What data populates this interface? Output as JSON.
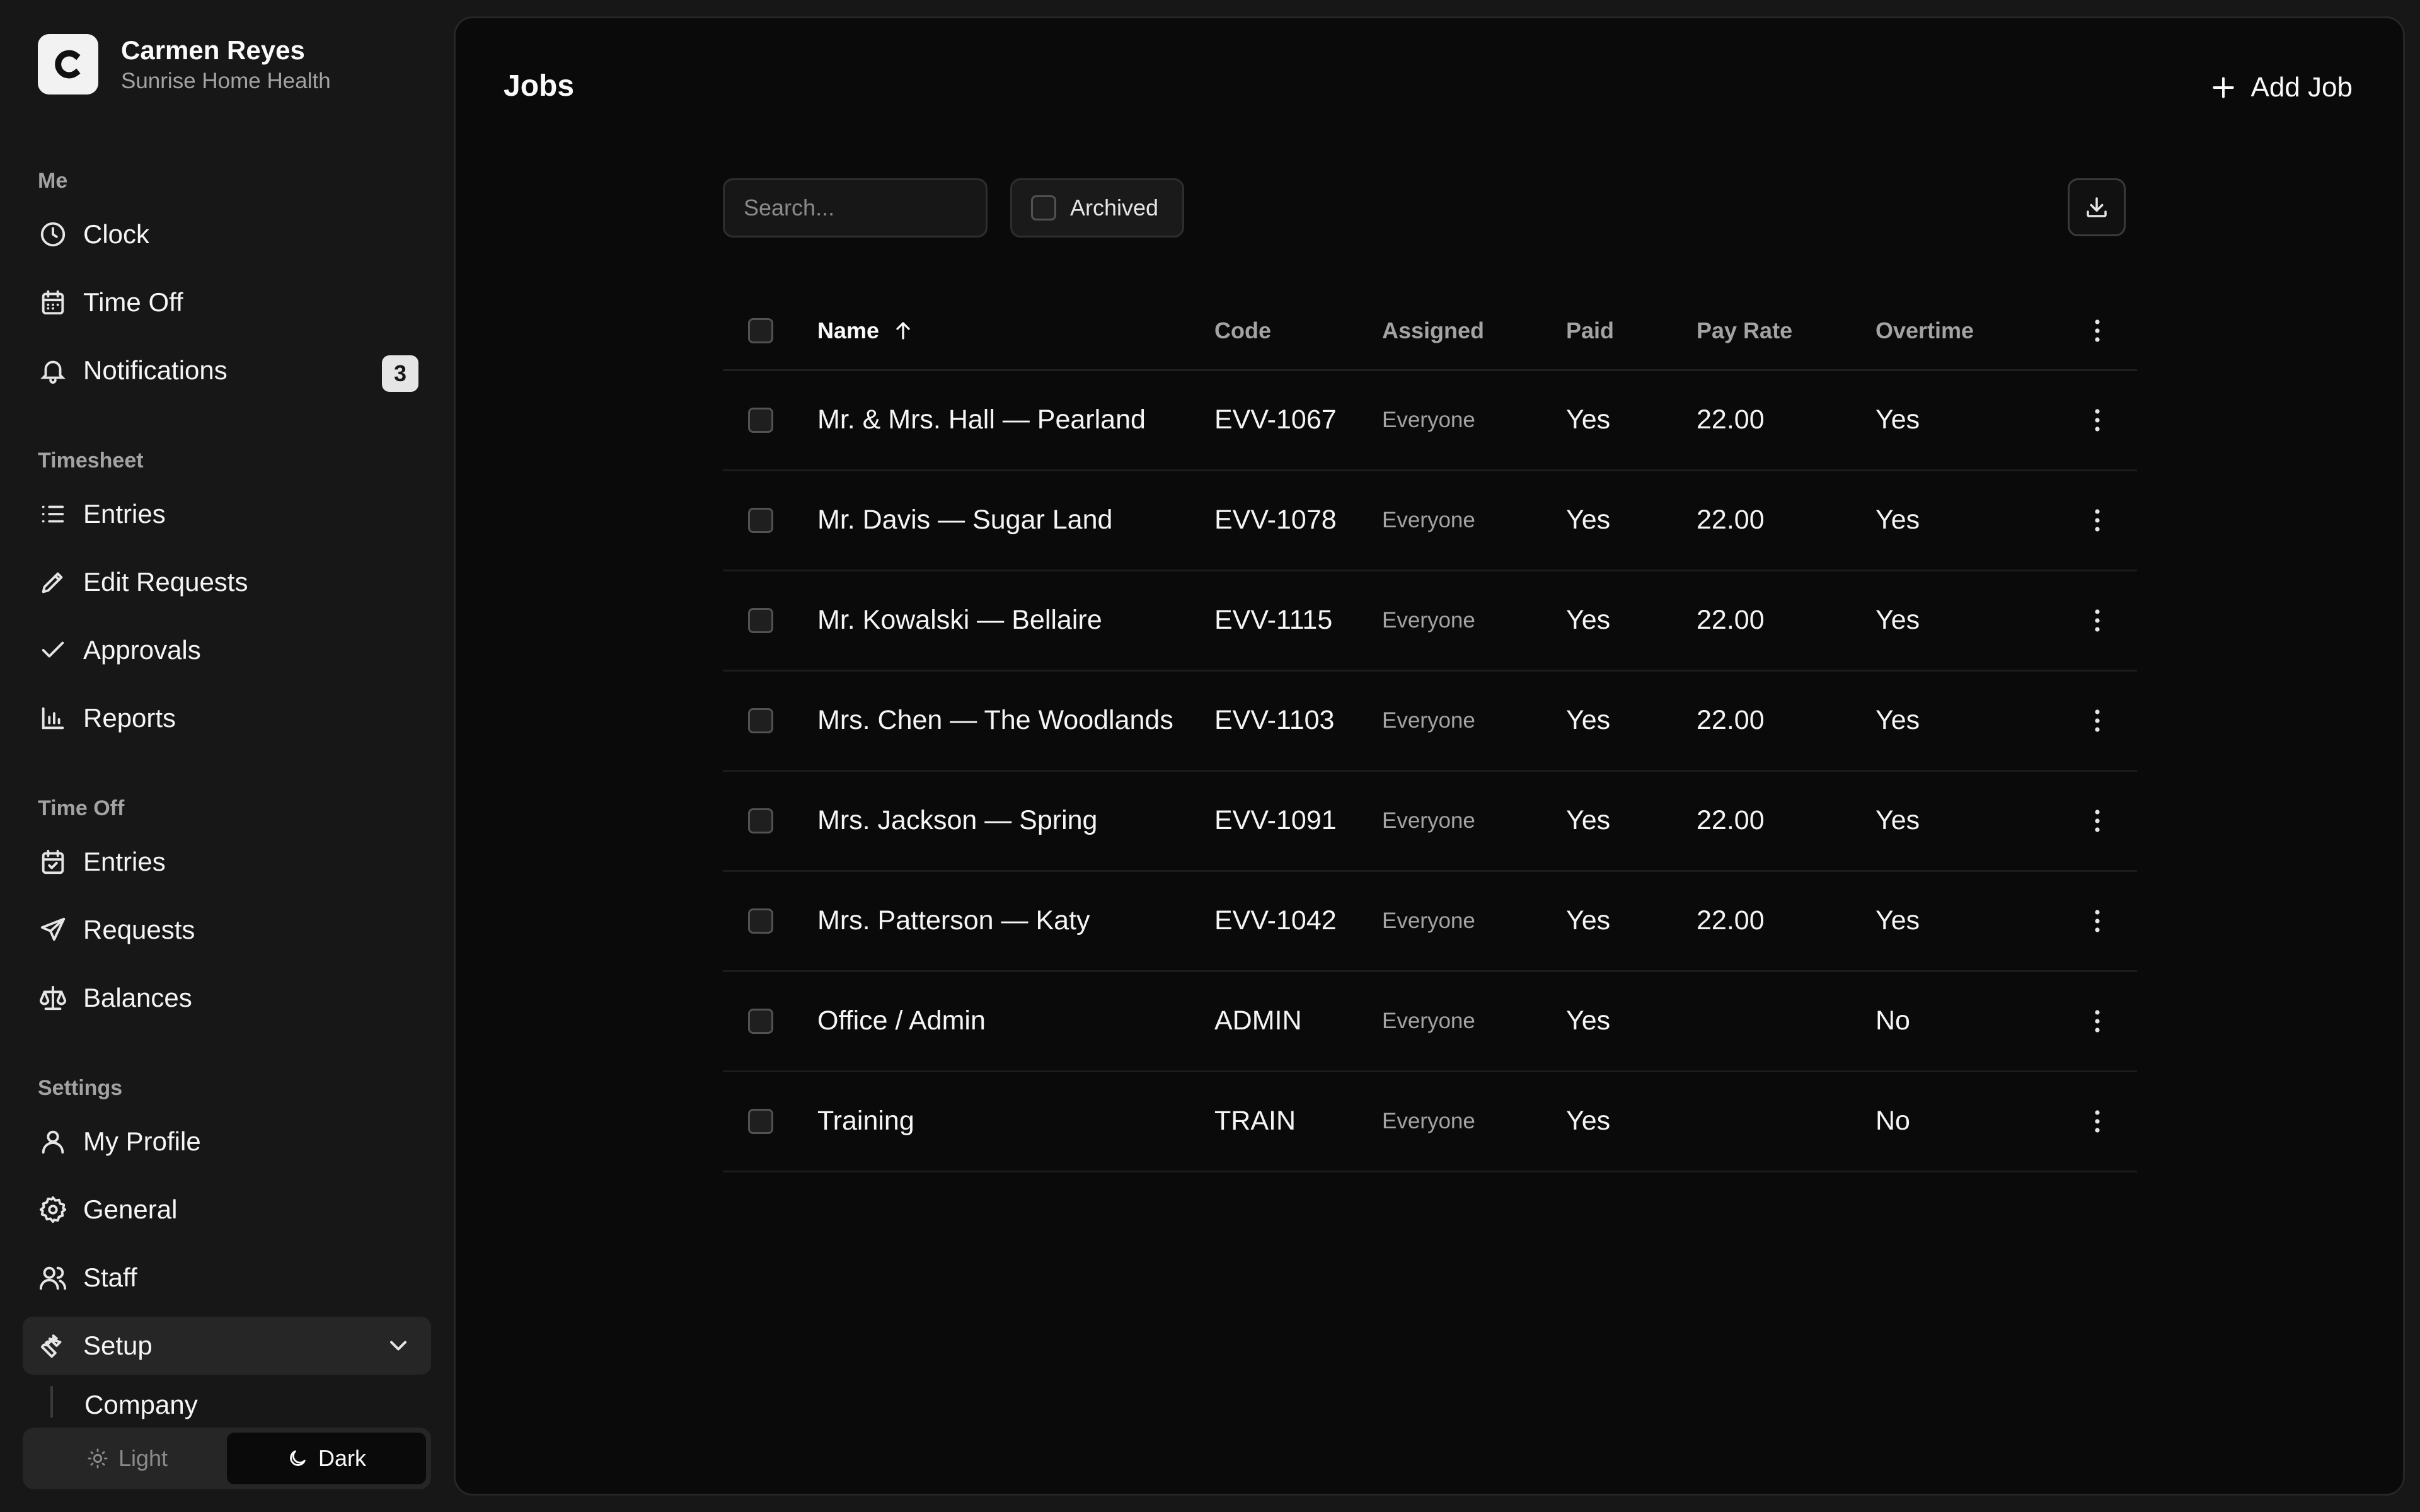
{
  "sidebar": {
    "brand": {
      "initial": "C",
      "name": "Carmen Reyes",
      "org": "Sunrise Home Health"
    },
    "sections": {
      "me": "Me",
      "timesheet": "Timesheet",
      "time_off": "Time Off",
      "settings": "Settings"
    },
    "items": {
      "clock": "Clock",
      "time_off": "Time Off",
      "notifications": "Notifications",
      "notifications_count": "3",
      "ts_entries": "Entries",
      "edit_requests": "Edit Requests",
      "approvals": "Approvals",
      "reports": "Reports",
      "to_entries": "Entries",
      "requests": "Requests",
      "balances": "Balances",
      "my_profile": "My Profile",
      "general": "General",
      "staff": "Staff",
      "setup": "Setup",
      "company": "Company"
    },
    "theme": {
      "light": "Light",
      "dark": "Dark",
      "selected": "Dark"
    }
  },
  "main": {
    "title": "Jobs",
    "add_label": "Add Job",
    "search_placeholder": "Search...",
    "archived_label": "Archived",
    "columns": [
      "Name",
      "Code",
      "Assigned",
      "Paid",
      "Pay Rate",
      "Overtime"
    ],
    "rows": [
      {
        "name": "Mr. & Mrs. Hall — Pearland",
        "code": "EVV-1067",
        "assigned": "Everyone",
        "paid": "Yes",
        "rate": "22.00",
        "overtime": "Yes"
      },
      {
        "name": "Mr. Davis — Sugar Land",
        "code": "EVV-1078",
        "assigned": "Everyone",
        "paid": "Yes",
        "rate": "22.00",
        "overtime": "Yes"
      },
      {
        "name": "Mr. Kowalski — Bellaire",
        "code": "EVV-1115",
        "assigned": "Everyone",
        "paid": "Yes",
        "rate": "22.00",
        "overtime": "Yes"
      },
      {
        "name": "Mrs. Chen — The Woodlands",
        "code": "EVV-1103",
        "assigned": "Everyone",
        "paid": "Yes",
        "rate": "22.00",
        "overtime": "Yes"
      },
      {
        "name": "Mrs. Jackson — Spring",
        "code": "EVV-1091",
        "assigned": "Everyone",
        "paid": "Yes",
        "rate": "22.00",
        "overtime": "Yes"
      },
      {
        "name": "Mrs. Patterson — Katy",
        "code": "EVV-1042",
        "assigned": "Everyone",
        "paid": "Yes",
        "rate": "22.00",
        "overtime": "Yes"
      },
      {
        "name": "Office / Admin",
        "code": "ADMIN",
        "assigned": "Everyone",
        "paid": "Yes",
        "rate": "",
        "overtime": "No"
      },
      {
        "name": "Training",
        "code": "TRAIN",
        "assigned": "Everyone",
        "paid": "Yes",
        "rate": "",
        "overtime": "No"
      }
    ]
  }
}
